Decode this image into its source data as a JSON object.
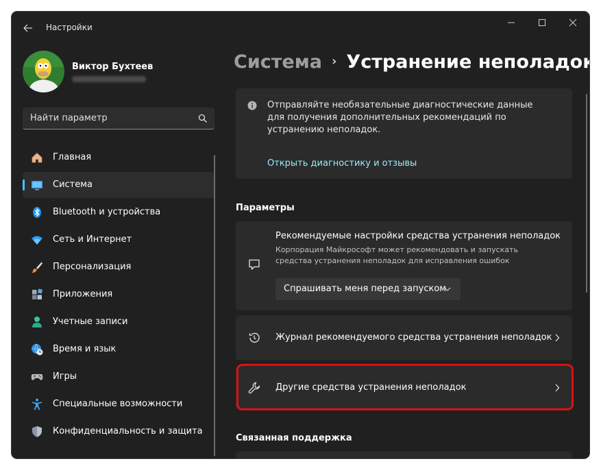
{
  "window": {
    "title": "Настройки"
  },
  "profile": {
    "name": "Виктор Бухтеев"
  },
  "search": {
    "placeholder": "Найти параметр"
  },
  "nav": {
    "items": [
      {
        "label": "Главная",
        "icon": "home-icon",
        "active": false
      },
      {
        "label": "Система",
        "icon": "system-display-icon",
        "active": true
      },
      {
        "label": "Bluetooth и устройства",
        "icon": "bluetooth-icon",
        "active": false
      },
      {
        "label": "Сеть и Интернет",
        "icon": "wifi-icon",
        "active": false
      },
      {
        "label": "Персонализация",
        "icon": "brush-icon",
        "active": false
      },
      {
        "label": "Приложения",
        "icon": "apps-icon",
        "active": false
      },
      {
        "label": "Учетные записи",
        "icon": "user-icon",
        "active": false
      },
      {
        "label": "Время и язык",
        "icon": "globe-clock-icon",
        "active": false
      },
      {
        "label": "Игры",
        "icon": "gamepad-icon",
        "active": false
      },
      {
        "label": "Специальные возможности",
        "icon": "accessibility-icon",
        "active": false
      },
      {
        "label": "Конфиденциальность и защита",
        "icon": "shield-icon",
        "active": false
      }
    ]
  },
  "breadcrumb": {
    "parent": "Система",
    "separator": "›",
    "current": "Устранение неполадок"
  },
  "info": {
    "text": "Отправляйте необязательные диагностические данные для получения дополнительных рекомендаций по устранению неполадок.",
    "link": "Открыть диагностику и отзывы"
  },
  "sections": {
    "params": "Параметры",
    "related": "Связанная поддержка"
  },
  "recommended": {
    "title": "Рекомендуемые настройки средства устранения неполадок",
    "description": "Корпорация Майкрософт может рекомендовать и запускать средства устранения неполадок для исправления ошибок",
    "select_value": "Спрашивать меня перед запуском"
  },
  "history": {
    "label": "Журнал рекомендуемого средства устранения неполадок"
  },
  "other": {
    "label": "Другие средства устранения неполадок"
  },
  "colors": {
    "accent": "#4cc2ff",
    "highlight": "#e01010",
    "link": "#99ebff"
  }
}
